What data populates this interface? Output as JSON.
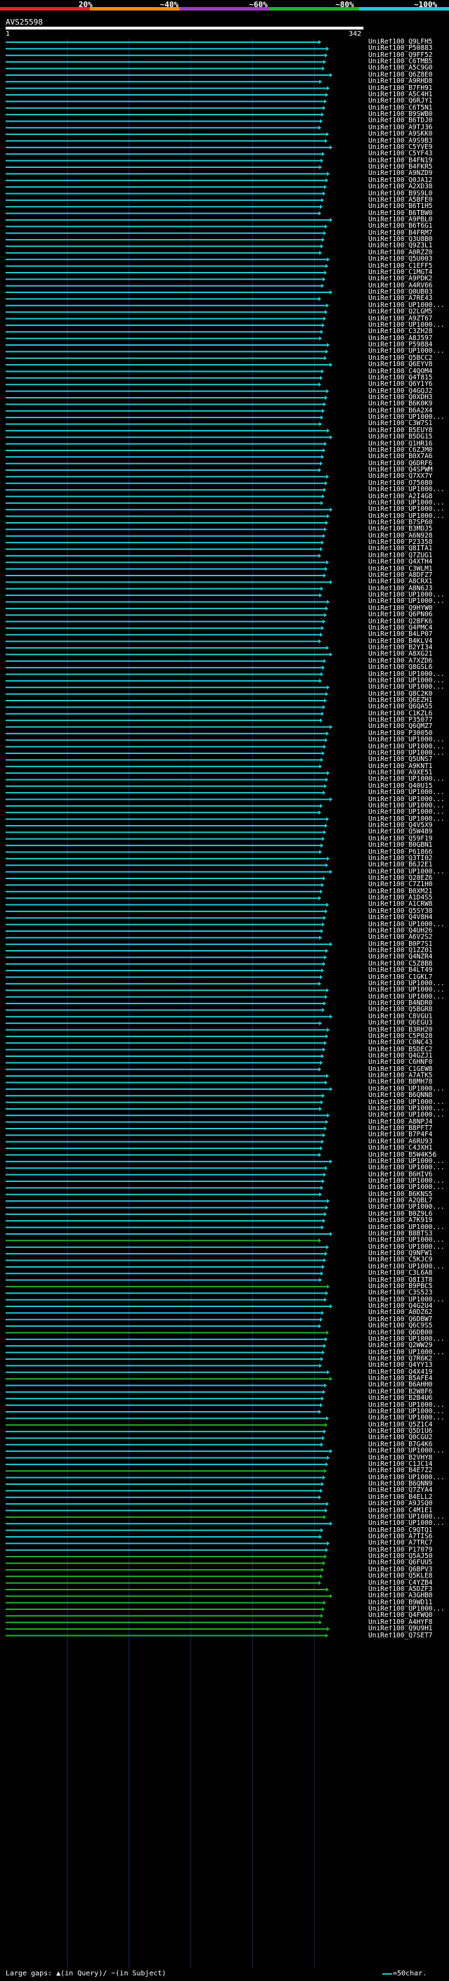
{
  "header": {
    "percent_labels": [
      "20%",
      "~40%",
      "~60%",
      "~80%",
      "~100%"
    ],
    "colors": [
      "#e8202a",
      "#f08c18",
      "#9b3fbf",
      "#21b22a",
      "#22c9d3"
    ]
  },
  "query": {
    "name": "AVS25598",
    "start": "1",
    "end": "342"
  },
  "footer": {
    "gaps_text": "Large gaps: ▲(in Query)/ ~(in Subject)",
    "scale_text": "=50char."
  },
  "hits": [
    "UniRef100_Q9LFH5",
    "UniRef100_P50883",
    "UniRef100_Q9FF52",
    "UniRef100_C6TMB5",
    "UniRef100_A5C9G0",
    "UniRef100_Q6Z8E0",
    "UniRef100_A9RHD8",
    "UniRef100_B7FH91",
    "UniRef100_A5C4H1",
    "UniRef100_Q6RJY1",
    "UniRef100_C6T5N1",
    "UniRef100_B9SWB0",
    "UniRef100_B6TDJ0",
    "UniRef100_A9TJ36",
    "UniRef100_A9SKK0",
    "UniRef100_A9S9B3",
    "UniRef100_C5YVE9",
    "UniRef100_C5YF43",
    "UniRef100_B4FN19",
    "UniRef100_B4FKR5",
    "UniRef100_A9NZD9",
    "UniRef100_Q0JA12",
    "UniRef100_A2XD38",
    "UniRef100_B9S9L0",
    "UniRef100_A5BFE0",
    "UniRef100_B6T1H5",
    "UniRef100_B6TBW0",
    "UniRef100_A9PBL0",
    "UniRef100_B6T6G1",
    "UniRef100_B4FRM7",
    "UniRef100_Q3U8B0",
    "UniRef100_Q9Z3L1",
    "UniRef100_A0RZZ0",
    "UniRef100_Q5U003",
    "UniRef100_C1EFF5",
    "UniRef100_C1MGT4",
    "UniRef100_A9PDK2",
    "UniRef100_A4RV66",
    "UniRef100_Q0UB03",
    "UniRef100_A7RE43",
    "UniRef100_UP1000...",
    "UniRef100_Q2LGM5",
    "UniRef100_A9ZT67",
    "UniRef100_UP1000...",
    "UniRef100_C3ZH28",
    "UniRef100_A8J597",
    "UniRef100_P59884",
    "UniRef100_UP1000...",
    "UniRef100_Q5BCC2",
    "UniRef100_Q6EYV8",
    "UniRef100_C4QOM4",
    "UniRef100_Q4T815",
    "UniRef100_Q6Y1Y6",
    "UniRef100_Q4GQJ2",
    "UniRef100_Q0XDH3",
    "UniRef100_B6K0K9",
    "UniRef100_B6A2X4",
    "UniRef100_UP1000...",
    "UniRef100_C3W7S1",
    "UniRef100_B5EUY8",
    "UniRef100_B5DG15",
    "UniRef100_Q1HR16",
    "UniRef100_C6ZJM0",
    "UniRef100_B0X7A6",
    "UniRef100_Q6DRF6",
    "UniRef100_Q4SPWM",
    "UniRef100_Q7XX7Y",
    "UniRef100_O75080",
    "UniRef100_UP1000...",
    "UniRef100_A2I4G8",
    "UniRef100_UP1000...",
    "UniRef100_UP1000...",
    "UniRef100_UP1000...",
    "UniRef100_B7SP60",
    "UniRef100_B3MDJ5",
    "UniRef100_A6N928",
    "UniRef100_P23358",
    "UniRef100_Q8ITA1",
    "UniRef100_Q7ZUG1",
    "UniRef100_Q4XTH4",
    "UniRef100_C3WLM1",
    "UniRef100_A8DFZ7",
    "UniRef100_A8CRX1",
    "UniRef100_A8N6J3",
    "UniRef100_UP1000...",
    "UniRef100_UP1000...",
    "UniRef100_Q9HYW0",
    "UniRef100_Q6PN06",
    "UniRef100_Q2BFK6",
    "UniRef100_Q4PMC4",
    "UniRef100_B4LP07",
    "UniRef100_B4KLV4",
    "UniRef100_B2YI34",
    "UniRef100_A8XG21",
    "UniRef100_A7XZD6",
    "UniRef100_Q8GSL6",
    "UniRef100_UP1000...",
    "UniRef100_UP1000...",
    "UniRef100_UP1000...",
    "UniRef100_Q8C2K0",
    "UniRef100_Q6EZH1",
    "UniRef100_Q6QA55",
    "UniRef100_C1KZL6",
    "UniRef100_P35077",
    "UniRef100_Q6QMZ7",
    "UniRef100_P30050",
    "UniRef100_UP1000...",
    "UniRef100_UP1000...",
    "UniRef100_UP1000...",
    "UniRef100_Q5UNS7",
    "UniRef100_A9KNT1",
    "UniRef100_A9XE51",
    "UniRef100_UP1000...",
    "UniRef100_Q40U15",
    "UniRef100_UP1000...",
    "UniRef100_UP1000...",
    "UniRef100_UP1000...",
    "UniRef100_UP1000...",
    "UniRef100_UP1000...",
    "UniRef100_Q4V5X9",
    "UniRef100_Q5W489",
    "UniRef100_Q59F19",
    "UniRef100_B0GBN1",
    "UniRef100_P61866",
    "UniRef100_Q3TI02",
    "UniRef100_B6J2E1",
    "UniRef100_UP1000...",
    "UniRef100_Q28EZ6",
    "UniRef100_C7Z1H0",
    "UniRef100_B0XM21",
    "UniRef100_A1D4S5",
    "UniRef100_A1CRW8",
    "UniRef100_Q5SY38",
    "UniRef100_Q4V8H4",
    "UniRef100_UP1000...",
    "UniRef100_Q4UH26",
    "UniRef100_A6V2S2",
    "UniRef100_B0P7S1",
    "UniRef100_Q1ZZ01",
    "UniRef100_Q4NZR4",
    "UniRef100_C5Z8B8",
    "UniRef100_B4LT49",
    "UniRef100_C1GKL7",
    "UniRef100_UP1000...",
    "UniRef100_UP1000...",
    "UniRef100_UP1000...",
    "UniRef100_B4NDR0",
    "UniRef100_Q5BGR8",
    "UniRef100_C8VGU1",
    "UniRef100_Q6EGU3",
    "UniRef100_B3RH20",
    "UniRef100_C5P028",
    "UniRef100_C0NC43",
    "UniRef100_B5DEC2",
    "UniRef100_Q4GZJ1",
    "UniRef100_C6HNF0",
    "UniRef100_C1GEW8",
    "UniRef100_A7ATK5",
    "UniRef100_B8MH78",
    "UniRef100_UP1000...",
    "UniRef100_B6QNN8",
    "UniRef100_UP1000...",
    "UniRef100_UP1000...",
    "UniRef100_UP1000...",
    "UniRef100_A8NPJ4",
    "UniRef100_B8PFT7",
    "UniRef100_B7P4F4",
    "UniRef100_A6RU93",
    "UniRef100_C4JXH1",
    "UniRef100_B5W4K56",
    "UniRef100_UP1000...",
    "UniRef100_UP1000...",
    "UniRef100_B6HIV6",
    "UniRef100_UP1000...",
    "UniRef100_UP1000...",
    "UniRef100_B6KNS5",
    "UniRef100_A2QBL7",
    "UniRef100_UP1000...",
    "UniRef100_B0Z9L6",
    "UniRef100_A7K919",
    "UniRef100_UP1000...",
    "UniRef100_B8BTS3",
    "UniRef100_UP1000...",
    "UniRef100_UP1000...",
    "UniRef100_Q9NFW1",
    "UniRef100_C5KJC9",
    "UniRef100_UP1000...",
    "UniRef100_C3L6A8",
    "UniRef100_Q8I3T8",
    "UniRef100_B9PBC5",
    "UniRef100_C3S523",
    "UniRef100_UP1000...",
    "UniRef100_Q4G2U4",
    "UniRef100_A0DZ62",
    "UniRef100_Q6DBW7",
    "UniRef100_Q6C9S5",
    "UniRef100_Q6DB00",
    "UniRef100_UP1000...",
    "UniRef100_Q2WW29",
    "UniRef100_UP1000...",
    "UniRef100_Q7R6K2",
    "UniRef100_Q4YY13",
    "UniRef100_Q4X419",
    "UniRef100_B5AFE4",
    "UniRef100_B6AHH0",
    "UniRef100_B2W8F6",
    "UniRef100_B2B4U6",
    "UniRef100_UP1000...",
    "UniRef100_UP1000...",
    "UniRef100_UP1000...",
    "UniRef100_Q5Z1C4",
    "UniRef100_Q5D1U6",
    "UniRef100_Q0CGU2",
    "UniRef100_B7G4K6",
    "UniRef100_UP1000...",
    "UniRef100_B2VHY8",
    "UniRef100_C1JC14",
    "UniRef100_B4E7Z2",
    "UniRef100_UP1000...",
    "UniRef100_B6QNN9",
    "UniRef100_Q7ZYA4",
    "UniRef100_B4ELL2",
    "UniRef100_A9JSQ0",
    "UniRef100_C4M1E1",
    "UniRef100_UP1000...",
    "UniRef100_UP1000...",
    "UniRef100_C9QTQ1",
    "UniRef100_A7TIS6",
    "UniRef100_A7TRC7",
    "UniRef100_P17079",
    "UniRef100_Q5AJ50",
    "UniRef100_Q6FUU5",
    "UniRef100_Q6BPV3",
    "UniRef100_Q5KLE8",
    "UniRef100_C4YZB4",
    "UniRef100_A5DZF3",
    "UniRef100_A3GHB0",
    "UniRef100_B9WD11",
    "UniRef100_UP1000...",
    "UniRef100_Q4FWQ0",
    "UniRef100_A4HYF8",
    "UniRef100_Q9U9H1",
    "UniRef100_Q7SET7"
  ]
}
